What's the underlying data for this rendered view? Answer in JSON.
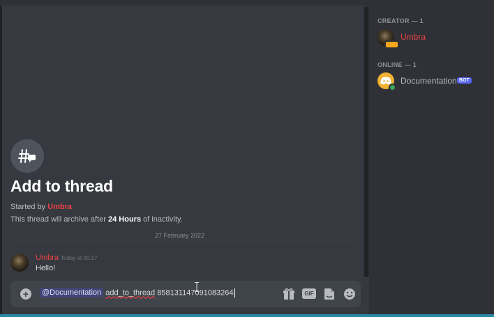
{
  "thread": {
    "title": "Add to thread",
    "started_by_prefix": "Started by ",
    "creator": "Umbra",
    "archive_prefix": "This thread will archive after ",
    "archive_hours": "24 Hours",
    "archive_suffix": " of inactivity."
  },
  "divider": {
    "date": "27 February 2022"
  },
  "message": {
    "author": "Umbra",
    "time": "Today at 00:17",
    "text": "Hello!"
  },
  "composer": {
    "mention": "@Documentation",
    "command": "add_to_thread",
    "argument": " 858131147091083264"
  },
  "composer_icons": [
    "add-circle-icon",
    "gift-icon",
    "gif-icon",
    "sticker-icon",
    "emoji-icon"
  ],
  "members": {
    "creator_header": "CREATOR — 1",
    "creator_name": "Umbra",
    "online_header": "ONLINE — 1",
    "bot_name": "Documentation",
    "bot_tag": "BOT"
  },
  "colors": {
    "background": "#36393f",
    "sidebar": "#2f3136",
    "creator_red": "#ed4245",
    "blurple": "#5865f2",
    "online_green": "#3ba55d"
  }
}
